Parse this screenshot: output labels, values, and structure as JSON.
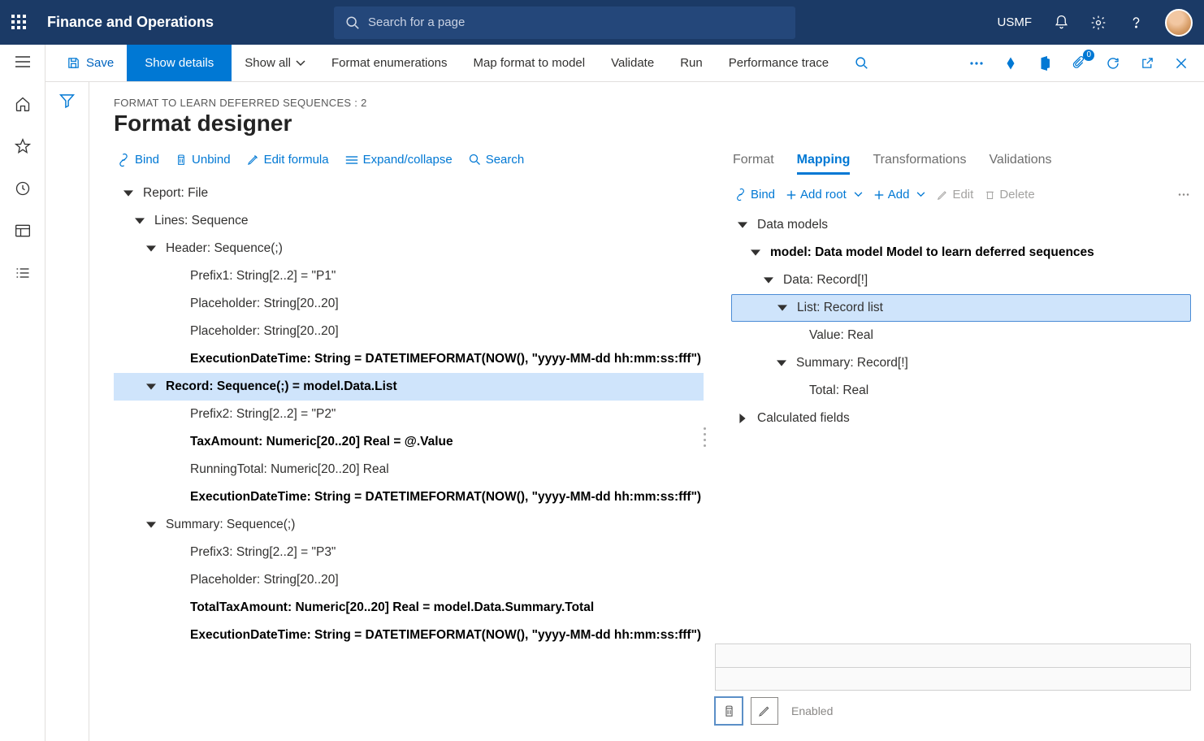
{
  "header": {
    "brand": "Finance and Operations",
    "search_placeholder": "Search for a page",
    "entity": "USMF"
  },
  "actionbar": {
    "save": "Save",
    "show_details": "Show details",
    "show_all": "Show all",
    "format_enum": "Format enumerations",
    "map_format": "Map format to model",
    "validate": "Validate",
    "run": "Run",
    "perf_trace": "Performance trace",
    "badge": "0"
  },
  "page": {
    "breadcrumb": "FORMAT TO LEARN DEFERRED SEQUENCES : 2",
    "title": "Format designer"
  },
  "left_toolbar": {
    "bind": "Bind",
    "unbind": "Unbind",
    "edit_formula": "Edit formula",
    "expand_collapse": "Expand/collapse",
    "search": "Search"
  },
  "format_tree": [
    {
      "indent": 0,
      "caret": true,
      "label": "Report: File",
      "bold": false
    },
    {
      "indent": 1,
      "caret": true,
      "label": "Lines: Sequence",
      "bold": false
    },
    {
      "indent": 2,
      "caret": true,
      "label": "Header: Sequence(;)",
      "bold": false
    },
    {
      "indent": 3,
      "caret": false,
      "label": "Prefix1: String[2..2] = \"P1\"",
      "bold": false
    },
    {
      "indent": 3,
      "caret": false,
      "label": "Placeholder: String[20..20]",
      "bold": false
    },
    {
      "indent": 3,
      "caret": false,
      "label": "Placeholder: String[20..20]",
      "bold": false
    },
    {
      "indent": 3,
      "caret": false,
      "label": "ExecutionDateTime: String = DATETIMEFORMAT(NOW(), \"yyyy-MM-dd hh:mm:ss:fff\")",
      "bold": true
    },
    {
      "indent": 2,
      "caret": true,
      "label": "Record: Sequence(;) = model.Data.List",
      "bold": true,
      "selected": true
    },
    {
      "indent": 3,
      "caret": false,
      "label": "Prefix2: String[2..2] = \"P2\"",
      "bold": false
    },
    {
      "indent": 3,
      "caret": false,
      "label": "TaxAmount: Numeric[20..20] Real = @.Value",
      "bold": true
    },
    {
      "indent": 3,
      "caret": false,
      "label": "RunningTotal: Numeric[20..20] Real",
      "bold": false
    },
    {
      "indent": 3,
      "caret": false,
      "label": "ExecutionDateTime: String = DATETIMEFORMAT(NOW(), \"yyyy-MM-dd hh:mm:ss:fff\")",
      "bold": true
    },
    {
      "indent": 2,
      "caret": true,
      "label": "Summary: Sequence(;)",
      "bold": false
    },
    {
      "indent": 3,
      "caret": false,
      "label": "Prefix3: String[2..2] = \"P3\"",
      "bold": false
    },
    {
      "indent": 3,
      "caret": false,
      "label": "Placeholder: String[20..20]",
      "bold": false
    },
    {
      "indent": 3,
      "caret": false,
      "label": "TotalTaxAmount: Numeric[20..20] Real = model.Data.Summary.Total",
      "bold": true
    },
    {
      "indent": 3,
      "caret": false,
      "label": "ExecutionDateTime: String = DATETIMEFORMAT(NOW(), \"yyyy-MM-dd hh:mm:ss:fff\")",
      "bold": true
    }
  ],
  "tabs": {
    "format": "Format",
    "mapping": "Mapping",
    "transformations": "Transformations",
    "validations": "Validations"
  },
  "right_toolbar": {
    "bind": "Bind",
    "add_root": "Add root",
    "add": "Add",
    "edit": "Edit",
    "delete": "Delete"
  },
  "mapping_tree": [
    {
      "indent": 0,
      "caret": "down",
      "label": "Data models",
      "bold": false
    },
    {
      "indent": 1,
      "caret": "down",
      "label": "model: Data model Model to learn deferred sequences",
      "bold": true
    },
    {
      "indent": 2,
      "caret": "down",
      "label": "Data: Record[!]",
      "bold": false
    },
    {
      "indent": 3,
      "caret": "down",
      "label": "List: Record list",
      "bold": false,
      "selected": true
    },
    {
      "indent": 4,
      "caret": "none",
      "label": "Value: Real",
      "bold": false
    },
    {
      "indent": 3,
      "caret": "down",
      "label": "Summary: Record[!]",
      "bold": false
    },
    {
      "indent": 4,
      "caret": "none",
      "label": "Total: Real",
      "bold": false
    },
    {
      "indent": 0,
      "caret": "right",
      "label": "Calculated fields",
      "bold": false
    }
  ],
  "bottom": {
    "enabled": "Enabled"
  }
}
